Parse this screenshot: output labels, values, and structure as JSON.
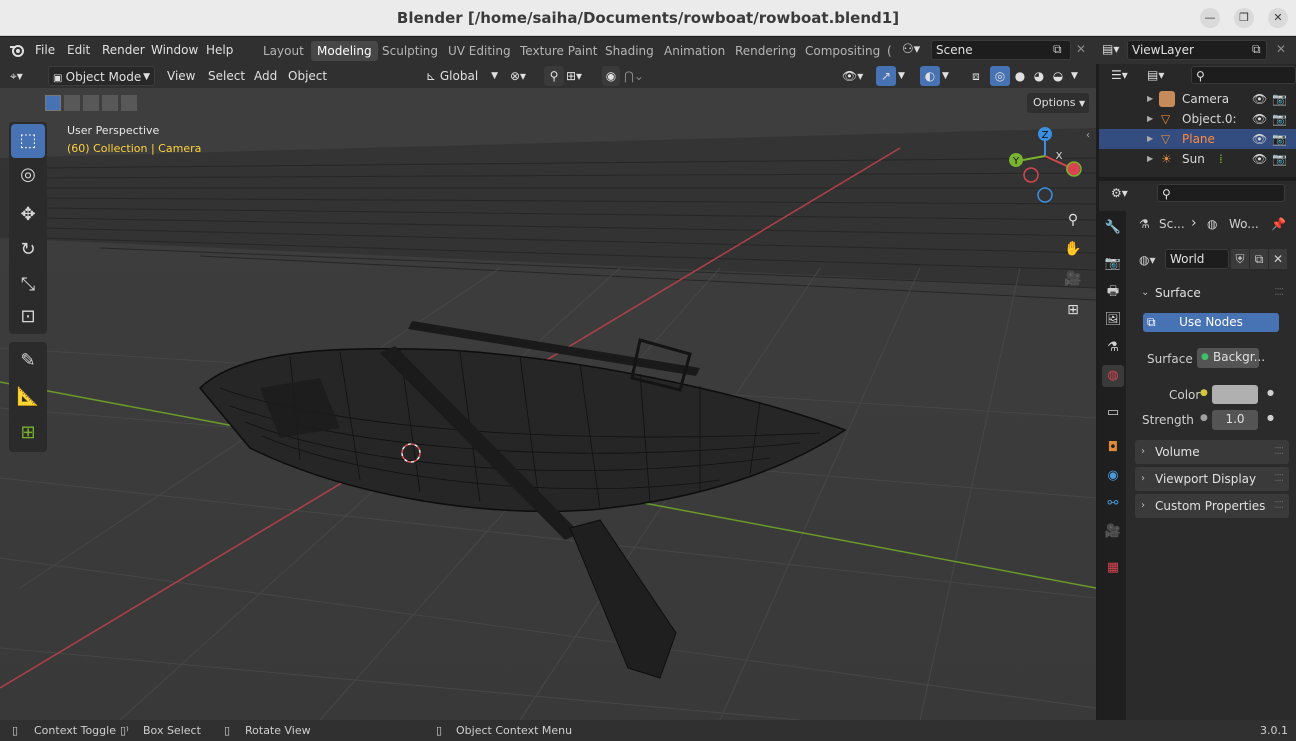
{
  "window": {
    "title": "Blender [/home/saiha/Documents/rowboat/rowboat.blend1]",
    "minimize": "—",
    "maximize": "❐",
    "close": "✕"
  },
  "menubar": {
    "file": "File",
    "edit": "Edit",
    "render": "Render",
    "window": "Window",
    "help": "Help",
    "workspaces": [
      "Layout",
      "Modeling",
      "Sculpting",
      "UV Editing",
      "Texture Paint",
      "Shading",
      "Animation",
      "Rendering",
      "Compositing",
      "("
    ],
    "active_workspace": "Modeling",
    "scene": "Scene",
    "view_layer": "ViewLayer"
  },
  "viewport_header": {
    "mode": "Object Mode",
    "view": "View",
    "select": "Select",
    "add": "Add",
    "object": "Object",
    "orientation": "Global",
    "options": "Options"
  },
  "viewport": {
    "perspective": "User Perspective",
    "collection": "(60) Collection | Camera",
    "gizmo": {
      "z": "Z",
      "y": "Y",
      "x": "X"
    }
  },
  "outliner": {
    "items": [
      {
        "label": "Camera",
        "color": "#d8d8d8",
        "icon": "camera-icon"
      },
      {
        "label": "Object.0:",
        "color": "#d8d8d8",
        "icon": "mesh-icon"
      },
      {
        "label": "Plane",
        "color": "#ff8a3d",
        "icon": "mesh-icon"
      },
      {
        "label": "Sun",
        "color": "#d8d8d8",
        "icon": "light-icon"
      }
    ]
  },
  "properties": {
    "breadcrumb_scene": "Sc...",
    "breadcrumb_world": "Wo...",
    "world_name": "World",
    "surface_panel": "Surface",
    "use_nodes": "Use Nodes",
    "surface_label": "Surface",
    "surface_value": "Backgr...",
    "color_label": "Color",
    "strength_label": "Strength",
    "strength_value": "1.0",
    "volume_panel": "Volume",
    "viewport_display_panel": "Viewport Display",
    "custom_properties_panel": "Custom Properties"
  },
  "statusbar": {
    "context_toggle": "Context Toggle",
    "box_select": "Box Select",
    "rotate_view": "Rotate View",
    "object_context_menu": "Object Context Menu",
    "version": "3.0.1"
  },
  "colors": {
    "accent": "#4772b3",
    "active_object": "#ff8a3d",
    "collection_text": "#ffd33d",
    "x_axis": "#d64550",
    "y_axis": "#7ab32e",
    "z_axis": "#3c8fe0"
  }
}
